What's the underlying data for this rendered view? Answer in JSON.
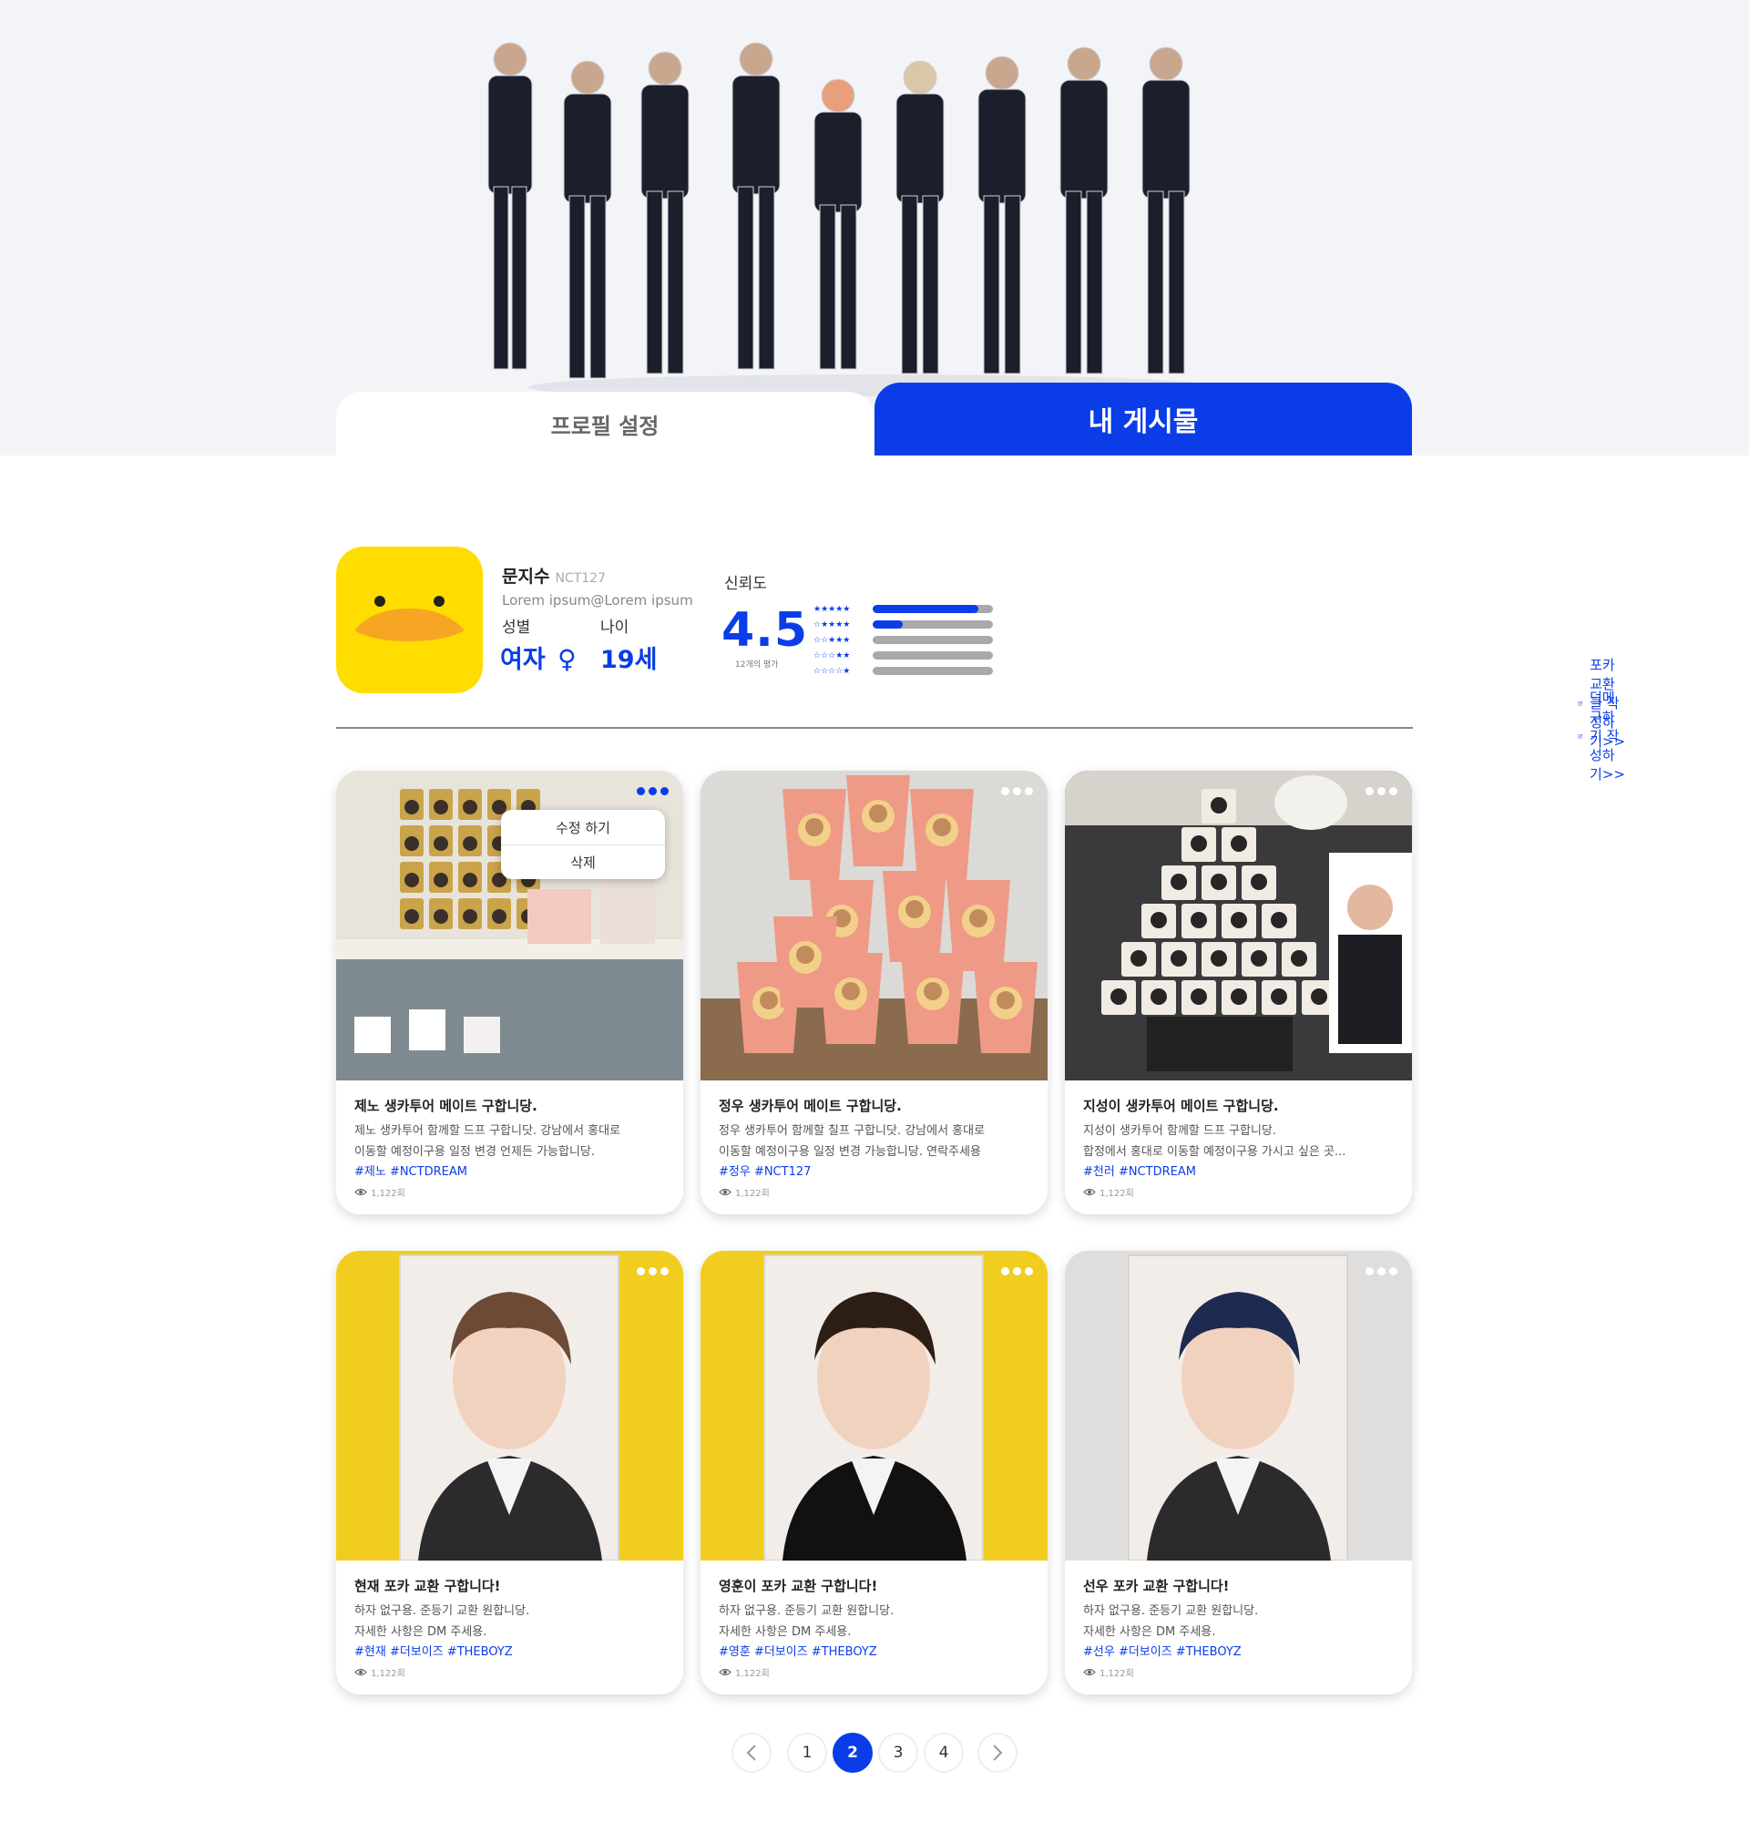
{
  "tabs": {
    "profile": "프로필 설정",
    "posts": "내 게시물"
  },
  "profile": {
    "name": "문지수",
    "group": "NCT127",
    "email": "Lorem ipsum@Lorem ipsum",
    "gender_label": "성별",
    "gender_value": "여자",
    "gender_symbol": "♀",
    "age_label": "나이",
    "age_value": "19세"
  },
  "trust": {
    "label": "신뢰도",
    "score": "4.5",
    "count_text": "12개의 평가",
    "rating_distribution": [
      {
        "stars": "★★★★★",
        "fraction": 0.88
      },
      {
        "stars": "☆★★★★",
        "fraction": 0.25
      },
      {
        "stars": "☆☆★★★",
        "fraction": 0.0
      },
      {
        "stars": "☆☆☆★★",
        "fraction": 0.0
      },
      {
        "stars": "☆☆☆☆★",
        "fraction": 0.0
      }
    ]
  },
  "actions": {
    "write_trade": "포카교환글 작성하기>>",
    "write_buy": "덕메 구하기 작성하기>>"
  },
  "menu": {
    "edit": "수정 하기",
    "delete": "삭제"
  },
  "posts": [
    {
      "title": "제노 생카투어 메이트 구합니당.",
      "desc1": "제노 생카투어 함께할 드프 구합니닷. 강남에서 홍대로",
      "desc2": "이동할 예정이구용 일정 변경 언제든 가능합니당.",
      "tags": "#제노 #NCTDREAM",
      "views": "1,122회",
      "image": "cafe-cups-shelf"
    },
    {
      "title": "정우 생카투어 메이트 구합니당.",
      "desc1": "정우 생카투어 함께할 칠프 구합니닷. 강남에서 홍대로",
      "desc2": "이동할 예정이구용 일정 변경 가능합니당. 연락주세용",
      "tags": "#정우 #NCT127",
      "views": "1,122회",
      "image": "pink-cups"
    },
    {
      "title": "지성이 생카투어 메이트 구합니당.",
      "desc1": "지성이 생카투어 함께할 드프 구합니당.",
      "desc2": "합정에서 홍대로 이동할 예정이구용 가시고 싶은 곳...",
      "tags": "#천러 #NCTDREAM",
      "views": "1,122회",
      "image": "cup-pyramid"
    },
    {
      "title": "현재 포카 교환 구합니다!",
      "desc1": "하자 없구용. 준등기 교환 원합니당.",
      "desc2": "자세한 사항은 DM 주세용.",
      "tags": "#현재 #더보이즈 #THEBOYZ",
      "views": "1,122회",
      "image": "photocard-yellow-1"
    },
    {
      "title": "영훈이 포카 교환 구합니다!",
      "desc1": "하자 없구용. 준등기 교환 원합니당.",
      "desc2": "자세한 사항은 DM 주세용.",
      "tags": "#영훈 #더보이즈 #THEBOYZ",
      "views": "1,122회",
      "image": "photocard-yellow-2"
    },
    {
      "title": "선우 포카 교환 구합니다!",
      "desc1": "하자 없구용. 준등기 교환 원합니당.",
      "desc2": "자세한 사항은 DM 주세용.",
      "tags": "#선우 #더보이즈 #THEBOYZ",
      "views": "1,122회",
      "image": "photocard-gray"
    }
  ],
  "pagination": {
    "pages": [
      "1",
      "2",
      "3",
      "4"
    ],
    "current": "2",
    "prev_icon": "chevron-left-icon",
    "next_icon": "chevron-right-icon"
  },
  "colors": {
    "accent": "#0a3de8",
    "avatar_bg": "#ffdd00",
    "hero_bg": "#f3f4f7"
  }
}
